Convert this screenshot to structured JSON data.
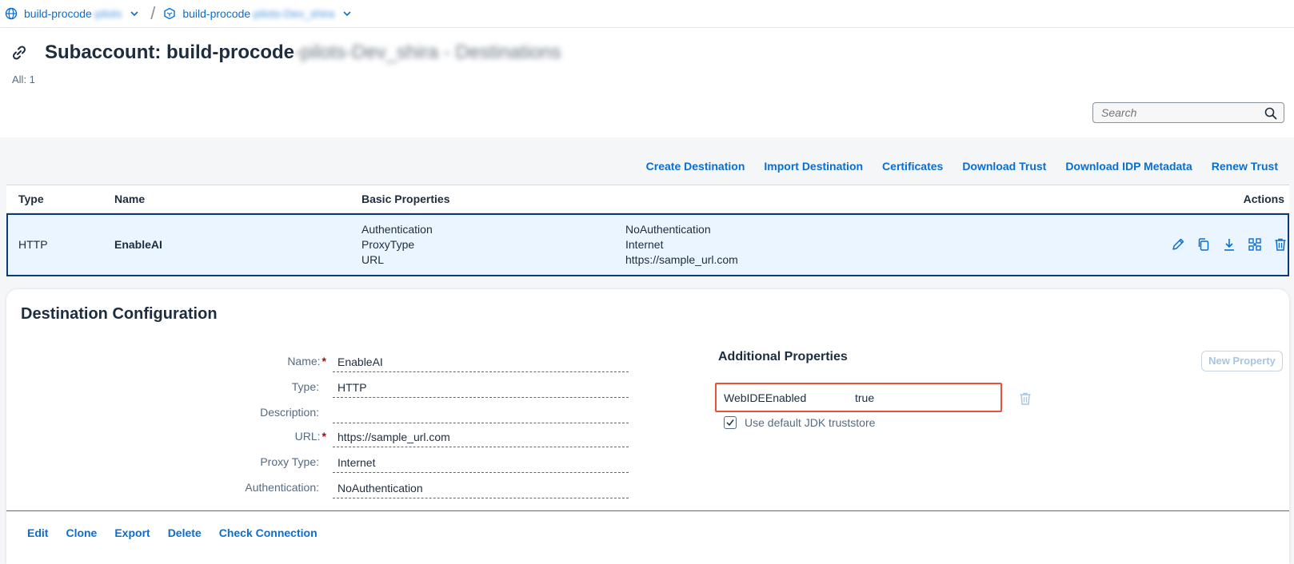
{
  "breadcrumb": {
    "item1_prefix": "build-procode",
    "item1_suffix": "-pilots",
    "item2_prefix": "build-procode",
    "item2_suffix": "-pilots-Dev_shira"
  },
  "header": {
    "title_prefix": "Subaccount: build-procode",
    "title_suffix": "-pilots-Dev_shira - Destinations",
    "count": "All: 1"
  },
  "search": {
    "placeholder": "Search"
  },
  "toolbar": {
    "create": "Create Destination",
    "import": "Import Destination",
    "certificates": "Certificates",
    "download_trust": "Download Trust",
    "download_idp": "Download IDP Metadata",
    "renew_trust": "Renew Trust"
  },
  "table": {
    "columns": {
      "type": "Type",
      "name": "Name",
      "basic": "Basic Properties",
      "actions": "Actions"
    },
    "row": {
      "type": "HTTP",
      "name": "EnableAI",
      "prop_labels": [
        "Authentication",
        "ProxyType",
        "URL"
      ],
      "prop_values": [
        "NoAuthentication",
        "Internet",
        "https://sample_url.com"
      ]
    }
  },
  "config": {
    "title": "Destination Configuration",
    "fields": {
      "name_label": "Name:",
      "name_value": "EnableAI",
      "type_label": "Type:",
      "type_value": "HTTP",
      "description_label": "Description:",
      "description_value": "",
      "url_label": "URL:",
      "url_value": "https://sample_url.com",
      "proxy_label": "Proxy Type:",
      "proxy_value": "Internet",
      "auth_label": "Authentication:",
      "auth_value": "NoAuthentication"
    },
    "additional": {
      "title": "Additional Properties",
      "new_property": "New Property",
      "property_key": "WebIDEEnabled",
      "property_value": "true",
      "jdk_label": "Use default JDK truststore"
    },
    "footer": {
      "edit": "Edit",
      "clone": "Clone",
      "export": "Export",
      "delete": "Delete",
      "check": "Check Connection"
    }
  },
  "colors": {
    "accent": "#0a6ed1",
    "selected_row": "#eaf5ff",
    "highlight": "#e5533d"
  }
}
